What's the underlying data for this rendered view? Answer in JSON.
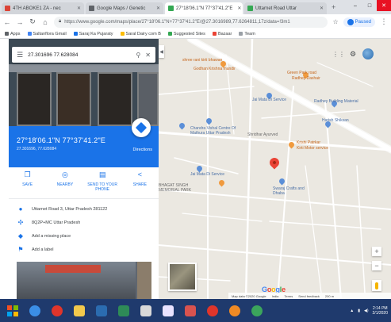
{
  "browser": {
    "tabs": [
      {
        "label": "4TH ABOKE1 ZA - nec",
        "favicon_color": "#db4437",
        "active": false
      },
      {
        "label": "Google Maps / Genetic",
        "favicon_color": "#5f6368",
        "active": false
      },
      {
        "label": "27°18'06.1\"N 77°37'41.2\"E",
        "favicon_color": "#34a853",
        "active": true
      },
      {
        "label": "Uttarnet Road Uttar",
        "favicon_color": "#34a853",
        "active": false
      }
    ],
    "new_tab": "+",
    "window_controls": {
      "minimize": "–",
      "maximize": "□",
      "close": "✕"
    },
    "url": "https://www.google.com/maps/place/27°18'06.1\"N+77°37'41.2\"E/@27.3016989,77.6264811,17z/data=!3m1",
    "paused_label": "Paused",
    "bookmarks": [
      {
        "label": "Apps",
        "color": "#5f6368"
      },
      {
        "label": "Saltanflora Gmail",
        "color": "#4285f4"
      },
      {
        "label": "Saraj Ka Pujaraty",
        "color": "#1a73e8"
      },
      {
        "label": "Saral Dairy com B",
        "color": "#fbbc05"
      },
      {
        "label": "Suggested Sites",
        "color": "#34a853"
      },
      {
        "label": "Bazaar",
        "color": "#ea4335"
      },
      {
        "label": "Team",
        "color": "#9aa0a6"
      }
    ]
  },
  "panel": {
    "search_value": "27.301696 77.628084",
    "coordinates": "27°18'06.1\"N 77°37'41.2\"E",
    "subtitle": "27.301696, 77.628084",
    "directions_label": "Directions",
    "actions": [
      {
        "icon": "save-icon",
        "glyph": "❐",
        "label": "SAVE"
      },
      {
        "icon": "nearby-icon",
        "glyph": "◎",
        "label": "NEARBY"
      },
      {
        "icon": "send-to-phone-icon",
        "glyph": "▤",
        "label": "SEND TO YOUR PHONE"
      },
      {
        "icon": "share-icon",
        "glyph": "<",
        "label": "SHARE"
      }
    ],
    "info": [
      {
        "icon": "location-pin-icon",
        "glyph": "●",
        "text": "Uttarnet Road 3, Uttar Pradesh 281122"
      },
      {
        "icon": "plus-code-icon",
        "glyph": "✣",
        "text": "8Q2P+MC Uttar Pradesh"
      },
      {
        "icon": "add-place-icon",
        "glyph": "◆",
        "text": "Add a missing place"
      },
      {
        "icon": "label-flag-icon",
        "glyph": "⚑",
        "text": "Add a label"
      }
    ]
  },
  "map": {
    "labels": [
      {
        "text": "shree rani kirti bhawan",
        "cls": "t-orange"
      },
      {
        "text": "Godhan Krishna mandir",
        "cls": "t-orange"
      },
      {
        "text": "Green Park road",
        "cls": "t-orange"
      },
      {
        "text": "Radhey Dashair",
        "cls": "t-orange"
      },
      {
        "text": "Jai Mata Di Service",
        "cls": "t-blue"
      },
      {
        "text": "Radhey Building Material",
        "cls": "t-blue"
      },
      {
        "text": "Harish Shiksan",
        "cls": "t-blue"
      },
      {
        "text": "Chandra Vishal Centre Of Mathura Uttar Pradesh",
        "cls": "t-blue"
      },
      {
        "text": "Shridhar Ayurved",
        "cls": "t-grey"
      },
      {
        "text": "Krishi Patrkar",
        "cls": "t-orange"
      },
      {
        "text": "Kirti Motor service",
        "cls": "t-orange"
      },
      {
        "text": "Jai Mata Di Service",
        "cls": "t-blue"
      },
      {
        "text": "BHAGAT SINGH MEMORIAL PARK",
        "cls": "t-grey"
      },
      {
        "text": "Swaraj Crafts and Dhaba",
        "cls": "t-blue"
      }
    ],
    "google_logo": [
      {
        "ch": "G",
        "color": "#4285f4"
      },
      {
        "ch": "o",
        "color": "#ea4335"
      },
      {
        "ch": "o",
        "color": "#fbbc05"
      },
      {
        "ch": "g",
        "color": "#4285f4"
      },
      {
        "ch": "l",
        "color": "#34a853"
      },
      {
        "ch": "e",
        "color": "#ea4335"
      }
    ],
    "footer": [
      "Map data ©2020 Google",
      "India",
      "Terms",
      "Send feedback",
      "200 m"
    ]
  },
  "taskbar": {
    "apps": [
      {
        "name": "ie-icon",
        "color": "#3b8ee6",
        "round": true
      },
      {
        "name": "opera-icon",
        "color": "#e0352b",
        "round": true
      },
      {
        "name": "file-explorer-icon",
        "color": "#f2c94c",
        "round": false
      },
      {
        "name": "word-icon",
        "color": "#2b6cb0",
        "round": false
      },
      {
        "name": "excel-icon",
        "color": "#2e8b57",
        "round": false
      },
      {
        "name": "pencil-icon",
        "color": "#d9d9d9",
        "round": false
      },
      {
        "name": "media-player-icon",
        "color": "#e9e3ff",
        "round": false
      },
      {
        "name": "powerpoint-icon",
        "color": "#d9534f",
        "round": false
      },
      {
        "name": "opera-icon-2",
        "color": "#e0352b",
        "round": true
      },
      {
        "name": "firefox-icon",
        "color": "#f08a24",
        "round": true
      },
      {
        "name": "chrome-icon",
        "color": "#3ba55c",
        "round": true
      }
    ],
    "time": "2:14 PM",
    "date": "2/1/2020"
  }
}
